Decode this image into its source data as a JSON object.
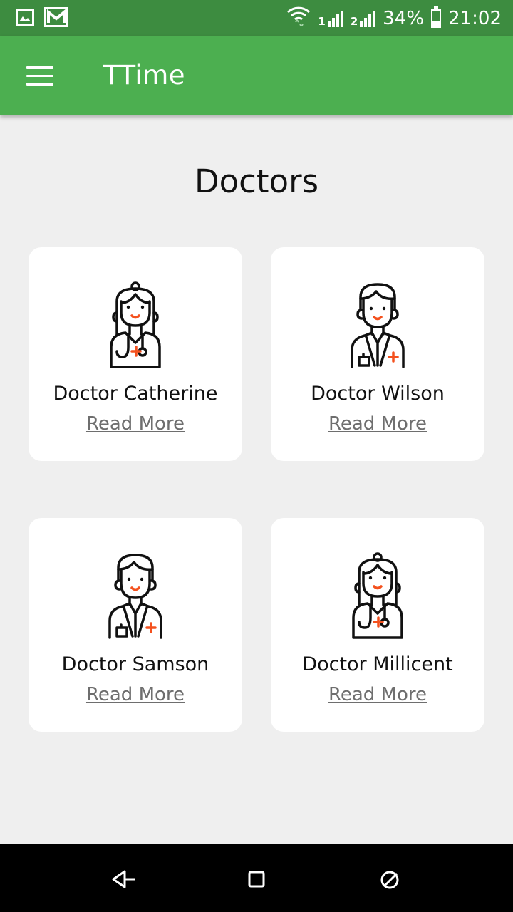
{
  "status_bar": {
    "signal_1": "1",
    "signal_2": "2",
    "battery_percent": "34%",
    "battery_level": 0.34,
    "time": "21:02",
    "icons": [
      "image-icon",
      "gmail-icon",
      "wifi-icon",
      "signal-icon",
      "battery-icon"
    ]
  },
  "app_bar": {
    "title": "TTime",
    "menu_icon": "hamburger-menu-icon"
  },
  "main": {
    "title": "Doctors",
    "doctors": [
      {
        "name": "Doctor Catherine",
        "link": "Read More",
        "avatar": "female-doctor-icon"
      },
      {
        "name": "Doctor Wilson",
        "link": "Read More",
        "avatar": "male-doctor-icon"
      },
      {
        "name": "Doctor Samson",
        "link": "Read More",
        "avatar": "male-doctor-icon"
      },
      {
        "name": "Doctor Millicent",
        "link": "Read More",
        "avatar": "female-doctor-icon"
      }
    ]
  },
  "nav_bar": {
    "icons": [
      "back-icon",
      "home-icon",
      "recents-icon"
    ]
  },
  "colors": {
    "status_bar": "#3d8c40",
    "app_bar": "#4caf50",
    "background": "#efefef",
    "card": "#ffffff",
    "accent_red": "#f4511e"
  }
}
